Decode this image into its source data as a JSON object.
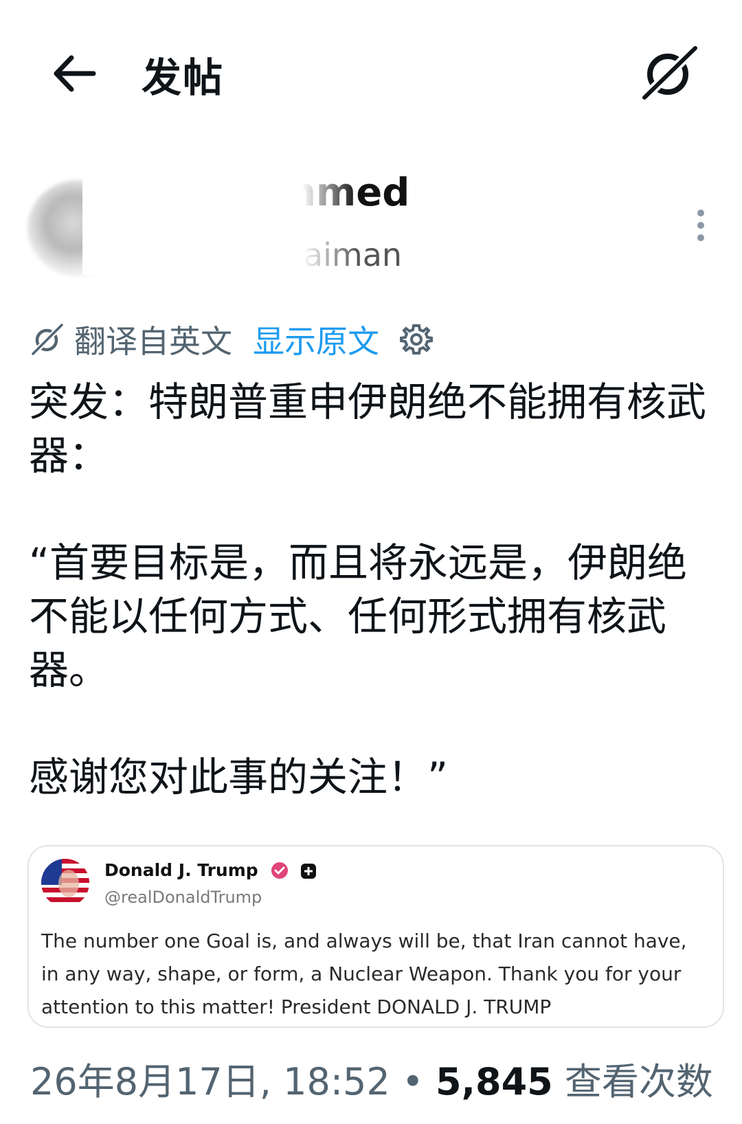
{
  "header": {
    "title": "发帖",
    "back_icon": "arrow-left-icon",
    "grok_icon": "grok-icon"
  },
  "author": {
    "display_name": "hmed",
    "handle": "ulaiman",
    "more_icon": "more-vertical-icon"
  },
  "translation": {
    "label": "翻译自英文",
    "show_original": "显示原文",
    "icon": "grok-icon",
    "settings_icon": "gear-icon",
    "link_color": "#1d9bf0"
  },
  "post": {
    "paragraphs": [
      "突发：特朗普重申伊朗绝不能拥有核武器：",
      "“首要目标是，而且将永远是，伊朗绝不能以任何方式、任何形式拥有核武器。",
      "感谢您对此事的关注！”"
    ]
  },
  "quoted_post": {
    "name": "Donald J. Trump",
    "handle": "@realDonaldTrump",
    "text": "The number one Goal is, and always will be, that Iran cannot have, in any way, shape, or form, a Nuclear Weapon. Thank you for your attention to this matter! President DONALD J. TRUMP",
    "verified_icon": "verified-badge-icon",
    "plus_icon": "plus-badge-icon",
    "verified_color": "#e0457b"
  },
  "meta": {
    "date": "26年8月17日, 18:52",
    "separator": "•",
    "views_count": "5,845",
    "views_label": "查看次数"
  }
}
